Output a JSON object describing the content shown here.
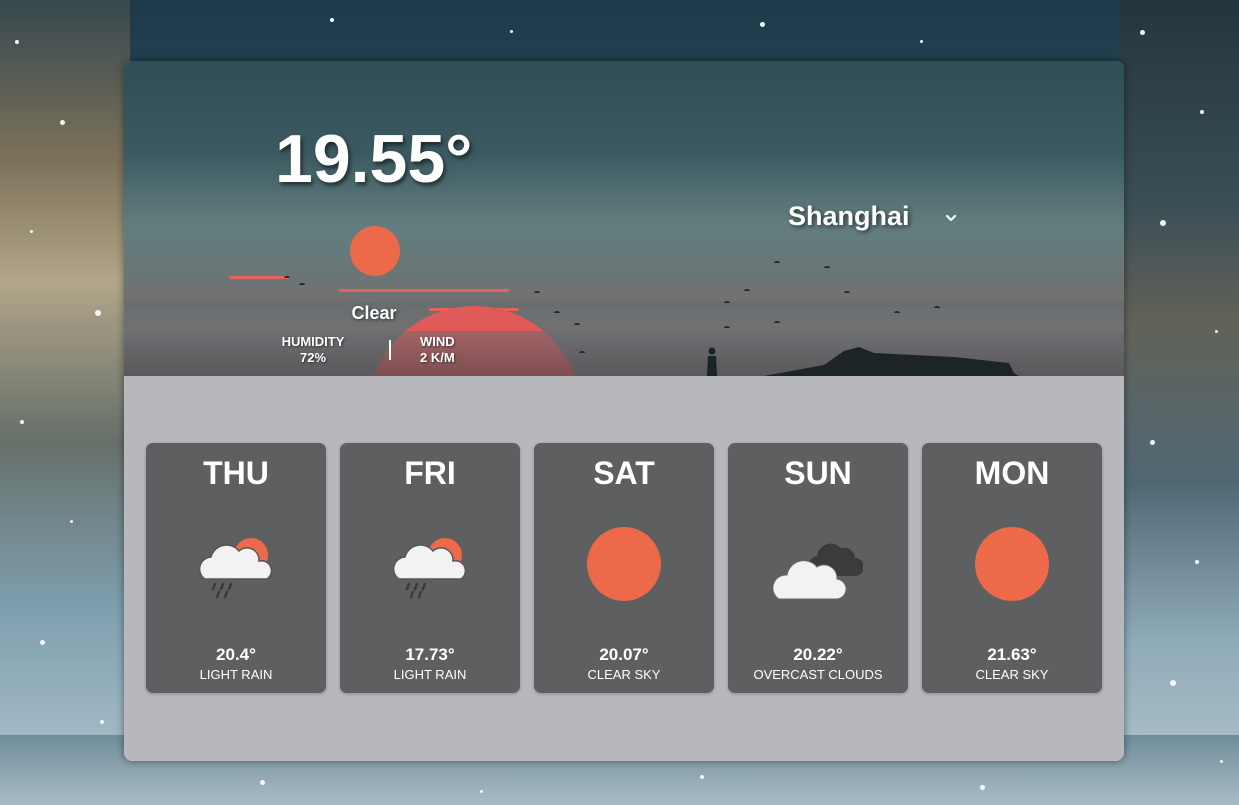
{
  "current": {
    "temperature": "19.55°",
    "icon": "sun-icon",
    "description": "Clear",
    "humidity_label": "HUMIDITY",
    "humidity_value": "72%",
    "wind_label": "WIND",
    "wind_value": "2 K/M"
  },
  "location": {
    "city": "Shanghai",
    "selector_icon": "chevron-down-icon"
  },
  "forecast": [
    {
      "day": "THU",
      "temp": "20.4°",
      "desc": "LIGHT RAIN",
      "icon": "rain-cloud-sun-icon"
    },
    {
      "day": "FRI",
      "temp": "17.73°",
      "desc": "LIGHT RAIN",
      "icon": "rain-cloud-sun-icon"
    },
    {
      "day": "SAT",
      "temp": "20.07°",
      "desc": "CLEAR SKY",
      "icon": "sun-icon"
    },
    {
      "day": "SUN",
      "temp": "20.22°",
      "desc": "OVERCAST CLOUDS",
      "icon": "overcast-clouds-icon"
    },
    {
      "day": "MON",
      "temp": "21.63°",
      "desc": "CLEAR SKY",
      "icon": "sun-icon"
    }
  ],
  "colors": {
    "sun": "#ec6a49",
    "card": "#5e5f61",
    "panel": "#b7b8bc"
  }
}
